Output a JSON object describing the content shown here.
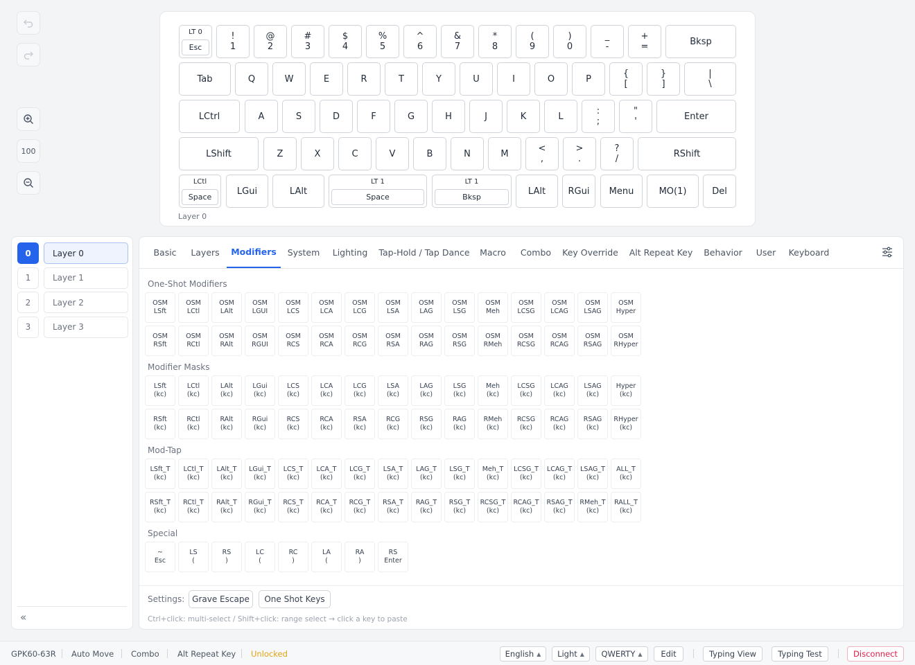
{
  "toolbar": {
    "undo_icon": "undo-icon",
    "redo_icon": "redo-icon",
    "zoom_in_icon": "zoom-in-icon",
    "zoom_level": "100",
    "zoom_out_icon": "zoom-out-icon"
  },
  "keyboard": {
    "layer_label": "Layer 0",
    "rows": [
      [
        {
          "type": "lt",
          "top": "LT 0",
          "bottom": "Esc"
        },
        {
          "s": "!",
          "m": "1"
        },
        {
          "s": "@",
          "m": "2"
        },
        {
          "s": "#",
          "m": "3"
        },
        {
          "s": "$",
          "m": "4"
        },
        {
          "s": "%",
          "m": "5"
        },
        {
          "s": "^",
          "m": "6"
        },
        {
          "s": "&",
          "m": "7"
        },
        {
          "s": "*",
          "m": "8"
        },
        {
          "s": "(",
          "m": "9"
        },
        {
          "s": ")",
          "m": "0"
        },
        {
          "s": "_",
          "m": "-"
        },
        {
          "s": "+",
          "m": "="
        },
        {
          "m": "Bksp"
        }
      ],
      [
        {
          "m": "Tab"
        },
        {
          "m": "Q"
        },
        {
          "m": "W"
        },
        {
          "m": "E"
        },
        {
          "m": "R"
        },
        {
          "m": "T"
        },
        {
          "m": "Y"
        },
        {
          "m": "U"
        },
        {
          "m": "I"
        },
        {
          "m": "O"
        },
        {
          "m": "P"
        },
        {
          "s": "{",
          "m": "["
        },
        {
          "s": "}",
          "m": "]"
        },
        {
          "s": "|",
          "m": "\\"
        }
      ],
      [
        {
          "m": "LCtrl"
        },
        {
          "m": "A"
        },
        {
          "m": "S"
        },
        {
          "m": "D"
        },
        {
          "m": "F"
        },
        {
          "m": "G"
        },
        {
          "m": "H"
        },
        {
          "m": "J"
        },
        {
          "m": "K"
        },
        {
          "m": "L"
        },
        {
          "s": ":",
          "m": ";"
        },
        {
          "s": "\"",
          "m": "'"
        },
        {
          "m": "Enter"
        }
      ],
      [
        {
          "m": "LShift"
        },
        {
          "m": "Z"
        },
        {
          "m": "X"
        },
        {
          "m": "C"
        },
        {
          "m": "V"
        },
        {
          "m": "B"
        },
        {
          "m": "N"
        },
        {
          "m": "M"
        },
        {
          "s": "<",
          "m": ","
        },
        {
          "s": ">",
          "m": "."
        },
        {
          "s": "?",
          "m": "/"
        },
        {
          "m": "RShift"
        }
      ],
      [
        {
          "type": "lt",
          "top": "LCtl",
          "bottom": "Space"
        },
        {
          "m": "LGui"
        },
        {
          "m": "LAlt"
        },
        {
          "type": "lt",
          "top": "LT 1",
          "bottom": "Space"
        },
        {
          "type": "lt",
          "top": "LT 1",
          "bottom": "Bksp"
        },
        {
          "m": "LAlt"
        },
        {
          "m": "RGui"
        },
        {
          "m": "Menu"
        },
        {
          "m": "MO(1)"
        },
        {
          "m": "Del"
        }
      ]
    ]
  },
  "layers": {
    "items": [
      {
        "num": "0",
        "name": "Layer 0",
        "active": true
      },
      {
        "num": "1",
        "name": "Layer 1",
        "active": false
      },
      {
        "num": "2",
        "name": "Layer 2",
        "active": false
      },
      {
        "num": "3",
        "name": "Layer 3",
        "active": false
      }
    ],
    "collapse_label": "«"
  },
  "tabs": {
    "items": [
      "Basic",
      "Layers",
      "Modifiers",
      "System",
      "Lighting",
      "Tap-Hold / Tap Dance",
      "Macro",
      "Combo",
      "Key Override",
      "Alt Repeat Key",
      "Behavior",
      "User",
      "Keyboard"
    ],
    "active": "Modifiers",
    "settings_icon": "sliders-icon"
  },
  "sections": [
    {
      "title": "One-Shot Modifiers",
      "rows": [
        [
          [
            "OSM",
            "LSft"
          ],
          [
            "OSM",
            "LCtl"
          ],
          [
            "OSM",
            "LAlt"
          ],
          [
            "OSM",
            "LGUI"
          ],
          [
            "OSM",
            "LCS"
          ],
          [
            "OSM",
            "LCA"
          ],
          [
            "OSM",
            "LCG"
          ],
          [
            "OSM",
            "LSA"
          ],
          [
            "OSM",
            "LAG"
          ],
          [
            "OSM",
            "LSG"
          ],
          [
            "OSM",
            "Meh"
          ],
          [
            "OSM",
            "LCSG"
          ],
          [
            "OSM",
            "LCAG"
          ],
          [
            "OSM",
            "LSAG"
          ],
          [
            "OSM",
            "Hyper"
          ]
        ],
        [
          [
            "OSM",
            "RSft"
          ],
          [
            "OSM",
            "RCtl"
          ],
          [
            "OSM",
            "RAlt"
          ],
          [
            "OSM",
            "RGUI"
          ],
          [
            "OSM",
            "RCS"
          ],
          [
            "OSM",
            "RCA"
          ],
          [
            "OSM",
            "RCG"
          ],
          [
            "OSM",
            "RSA"
          ],
          [
            "OSM",
            "RAG"
          ],
          [
            "OSM",
            "RSG"
          ],
          [
            "OSM",
            "RMeh"
          ],
          [
            "OSM",
            "RCSG"
          ],
          [
            "OSM",
            "RCAG"
          ],
          [
            "OSM",
            "RSAG"
          ],
          [
            "OSM",
            "RHyper"
          ]
        ]
      ]
    },
    {
      "title": "Modifier Masks",
      "rows": [
        [
          [
            "LSft",
            "(kc)"
          ],
          [
            "LCtl",
            "(kc)"
          ],
          [
            "LAlt",
            "(kc)"
          ],
          [
            "LGui",
            "(kc)"
          ],
          [
            "LCS",
            "(kc)"
          ],
          [
            "LCA",
            "(kc)"
          ],
          [
            "LCG",
            "(kc)"
          ],
          [
            "LSA",
            "(kc)"
          ],
          [
            "LAG",
            "(kc)"
          ],
          [
            "LSG",
            "(kc)"
          ],
          [
            "Meh",
            "(kc)"
          ],
          [
            "LCSG",
            "(kc)"
          ],
          [
            "LCAG",
            "(kc)"
          ],
          [
            "LSAG",
            "(kc)"
          ],
          [
            "Hyper",
            "(kc)"
          ]
        ],
        [
          [
            "RSft",
            "(kc)"
          ],
          [
            "RCtl",
            "(kc)"
          ],
          [
            "RAlt",
            "(kc)"
          ],
          [
            "RGui",
            "(kc)"
          ],
          [
            "RCS",
            "(kc)"
          ],
          [
            "RCA",
            "(kc)"
          ],
          [
            "RSA",
            "(kc)"
          ],
          [
            "RCG",
            "(kc)"
          ],
          [
            "RSG",
            "(kc)"
          ],
          [
            "RAG",
            "(kc)"
          ],
          [
            "RMeh",
            "(kc)"
          ],
          [
            "RCSG",
            "(kc)"
          ],
          [
            "RCAG",
            "(kc)"
          ],
          [
            "RSAG",
            "(kc)"
          ],
          [
            "RHyper",
            "(kc)"
          ]
        ]
      ]
    },
    {
      "title": "Mod-Tap",
      "rows": [
        [
          [
            "LSft_T",
            "(kc)"
          ],
          [
            "LCtl_T",
            "(kc)"
          ],
          [
            "LAlt_T",
            "(kc)"
          ],
          [
            "LGui_T",
            "(kc)"
          ],
          [
            "LCS_T",
            "(kc)"
          ],
          [
            "LCA_T",
            "(kc)"
          ],
          [
            "LCG_T",
            "(kc)"
          ],
          [
            "LSA_T",
            "(kc)"
          ],
          [
            "LAG_T",
            "(kc)"
          ],
          [
            "LSG_T",
            "(kc)"
          ],
          [
            "Meh_T",
            "(kc)"
          ],
          [
            "LCSG_T",
            "(kc)"
          ],
          [
            "LCAG_T",
            "(kc)"
          ],
          [
            "LSAG_T",
            "(kc)"
          ],
          [
            "ALL_T",
            "(kc)"
          ]
        ],
        [
          [
            "RSft_T",
            "(kc)"
          ],
          [
            "RCtl_T",
            "(kc)"
          ],
          [
            "RAlt_T",
            "(kc)"
          ],
          [
            "RGui_T",
            "(kc)"
          ],
          [
            "RCS_T",
            "(kc)"
          ],
          [
            "RCA_T",
            "(kc)"
          ],
          [
            "RCG_T",
            "(kc)"
          ],
          [
            "RSA_T",
            "(kc)"
          ],
          [
            "RAG_T",
            "(kc)"
          ],
          [
            "RSG_T",
            "(kc)"
          ],
          [
            "RCSG_T",
            "(kc)"
          ],
          [
            "RCAG_T",
            "(kc)"
          ],
          [
            "RSAG_T",
            "(kc)"
          ],
          [
            "RMeh_T",
            "(kc)"
          ],
          [
            "RALL_T",
            "(kc)"
          ]
        ]
      ]
    },
    {
      "title": "Special",
      "rows": [
        [
          [
            "~",
            "Esc"
          ],
          [
            "LS",
            "("
          ],
          [
            "RS",
            ")"
          ],
          [
            "LC",
            "("
          ],
          [
            "RC",
            ")"
          ],
          [
            "LA",
            "("
          ],
          [
            "RA",
            ")"
          ],
          [
            "RS",
            "Enter"
          ]
        ]
      ]
    }
  ],
  "settings": {
    "label": "Settings:",
    "grave_escape": "Grave Escape",
    "one_shot_keys": "One Shot Keys",
    "hint": "Ctrl+click: multi-select / Shift+click: range select → click a key to paste"
  },
  "status": {
    "device": "GPK60-63R",
    "auto_move": "Auto Move",
    "combo": "Combo",
    "alt_repeat": "Alt Repeat Key",
    "lock_state": "Unlocked",
    "language": "English",
    "theme": "Light",
    "layout": "QWERTY",
    "edit": "Edit",
    "typing_view": "Typing View",
    "typing_test": "Typing Test",
    "disconnect": "Disconnect",
    "colors": {
      "accent": "#2563eb",
      "warn": "#e0a313",
      "danger": "#e11d48"
    }
  }
}
